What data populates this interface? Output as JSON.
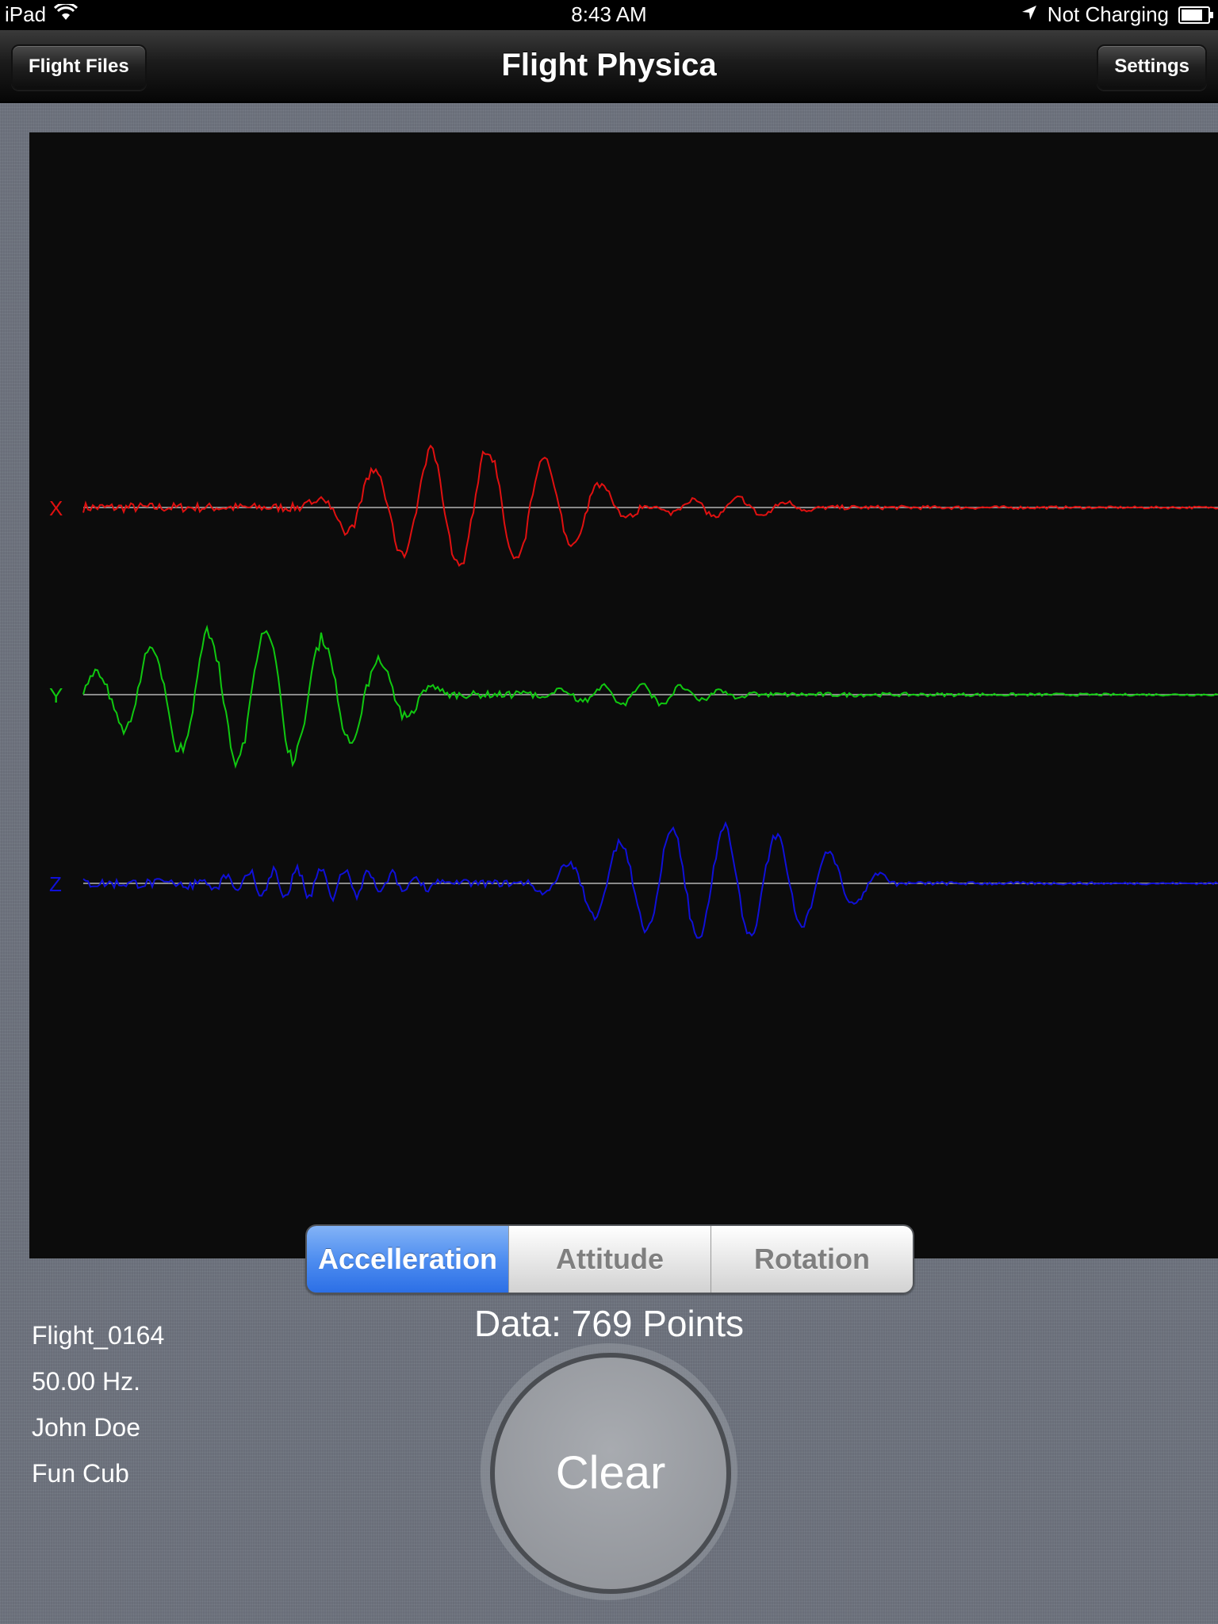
{
  "status_bar": {
    "device": "iPad",
    "time": "8:43 AM",
    "charging": "Not Charging"
  },
  "nav": {
    "title": "Flight Physica",
    "left_button": "Flight Files",
    "right_button": "Settings"
  },
  "plot": {
    "channels": [
      {
        "label": "X",
        "color": "#e01010"
      },
      {
        "label": "Y",
        "color": "#10c810"
      },
      {
        "label": "Z",
        "color": "#1010d8"
      }
    ]
  },
  "segments": [
    "Accelleration",
    "Attitude",
    "Rotation"
  ],
  "selected_segment": 0,
  "data_count": "Data: 769 Points",
  "flight_info": {
    "file": "Flight_0164",
    "rate": "50.00 Hz.",
    "pilot": "John Doe",
    "aircraft": "Fun Cub"
  },
  "clear_button": "Clear"
}
